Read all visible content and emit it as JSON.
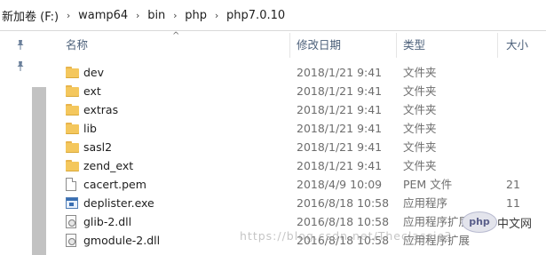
{
  "address_bar": {
    "segments": [
      "新加卷 (F:)",
      "wamp64",
      "bin",
      "php",
      "php7.0.10"
    ],
    "separator": "›"
  },
  "columns": {
    "name": "名称",
    "date": "修改日期",
    "type": "类型",
    "size": "大小"
  },
  "rows": [
    {
      "icon": "folder-icon",
      "name": "dev",
      "date": "2018/1/21 9:41",
      "type": "文件夹",
      "size": ""
    },
    {
      "icon": "folder-icon",
      "name": "ext",
      "date": "2018/1/21 9:41",
      "type": "文件夹",
      "size": ""
    },
    {
      "icon": "folder-icon",
      "name": "extras",
      "date": "2018/1/21 9:41",
      "type": "文件夹",
      "size": ""
    },
    {
      "icon": "folder-icon",
      "name": "lib",
      "date": "2018/1/21 9:41",
      "type": "文件夹",
      "size": ""
    },
    {
      "icon": "folder-icon",
      "name": "sasl2",
      "date": "2018/1/21 9:41",
      "type": "文件夹",
      "size": ""
    },
    {
      "icon": "folder-icon",
      "name": "zend_ext",
      "date": "2018/1/21 9:41",
      "type": "文件夹",
      "size": ""
    },
    {
      "icon": "file-icon",
      "name": "cacert.pem",
      "date": "2018/4/9 10:09",
      "type": "PEM 文件",
      "size": "21"
    },
    {
      "icon": "exe-icon",
      "name": "deplister.exe",
      "date": "2016/8/18 10:58",
      "type": "应用程序",
      "size": "11"
    },
    {
      "icon": "dll-icon",
      "name": "glib-2.dll",
      "date": "2016/8/18 10:58",
      "type": "应用程序扩展",
      "size": ""
    },
    {
      "icon": "dll-icon",
      "name": "gmodule-2.dll",
      "date": "2016/8/18 10:58",
      "type": "应用程序扩展",
      "size": ""
    }
  ],
  "watermark": {
    "url": "https://blog.csdn.net/Theclassic3",
    "logo_text": "php",
    "site_text": "中文网"
  },
  "colors": {
    "header_text": "#4c607a",
    "secondary_text": "#6d6d6d",
    "folder": "#f4c75d"
  }
}
